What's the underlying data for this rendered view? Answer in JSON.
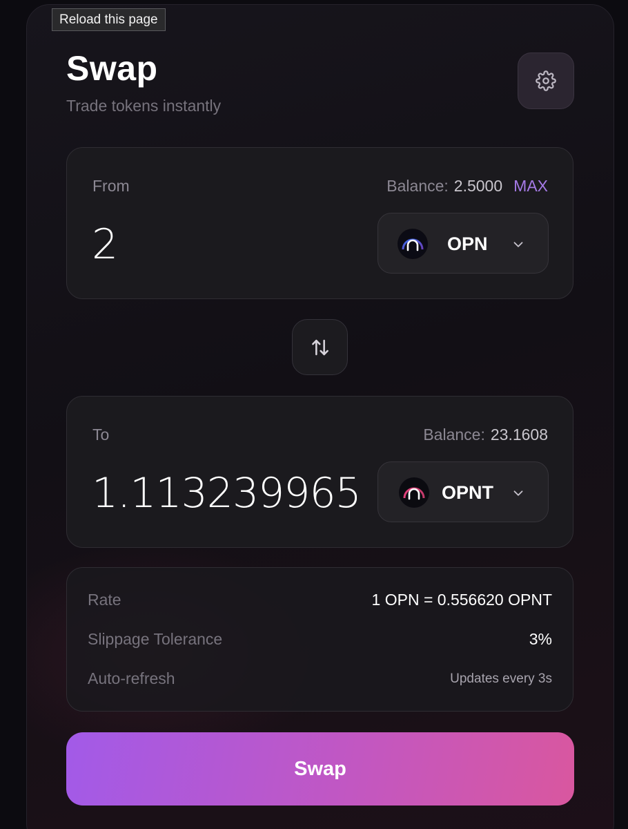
{
  "tooltip": "Reload this page",
  "header": {
    "title": "Swap",
    "subtitle": "Trade tokens instantly",
    "settings_icon": "gear-icon"
  },
  "from": {
    "label": "From",
    "balance_label": "Balance:",
    "balance_value": "2.5000",
    "max_label": "MAX",
    "amount": "2",
    "token": {
      "symbol": "OPN",
      "logo": "opn-logo-icon",
      "chevron": "chevron-down-icon"
    }
  },
  "swap_direction_icon": "swap-arrows-icon",
  "to": {
    "label": "To",
    "balance_label": "Balance:",
    "balance_value": "23.1608",
    "amount": "1.11323996544",
    "token": {
      "symbol": "OPNT",
      "logo": "opnt-logo-icon",
      "chevron": "chevron-down-icon"
    }
  },
  "info": {
    "rate_label": "Rate",
    "rate_value": "1 OPN = 0.556620 OPNT",
    "slippage_label": "Slippage Tolerance",
    "slippage_value": "3%",
    "refresh_label": "Auto-refresh",
    "refresh_value": "Updates every 3s"
  },
  "action": {
    "swap_label": "Swap"
  },
  "colors": {
    "accent": "#a57ae6",
    "button_gradient_start": "#a25ae8",
    "button_gradient_end": "#d9579f",
    "background": "#0c0b10"
  }
}
